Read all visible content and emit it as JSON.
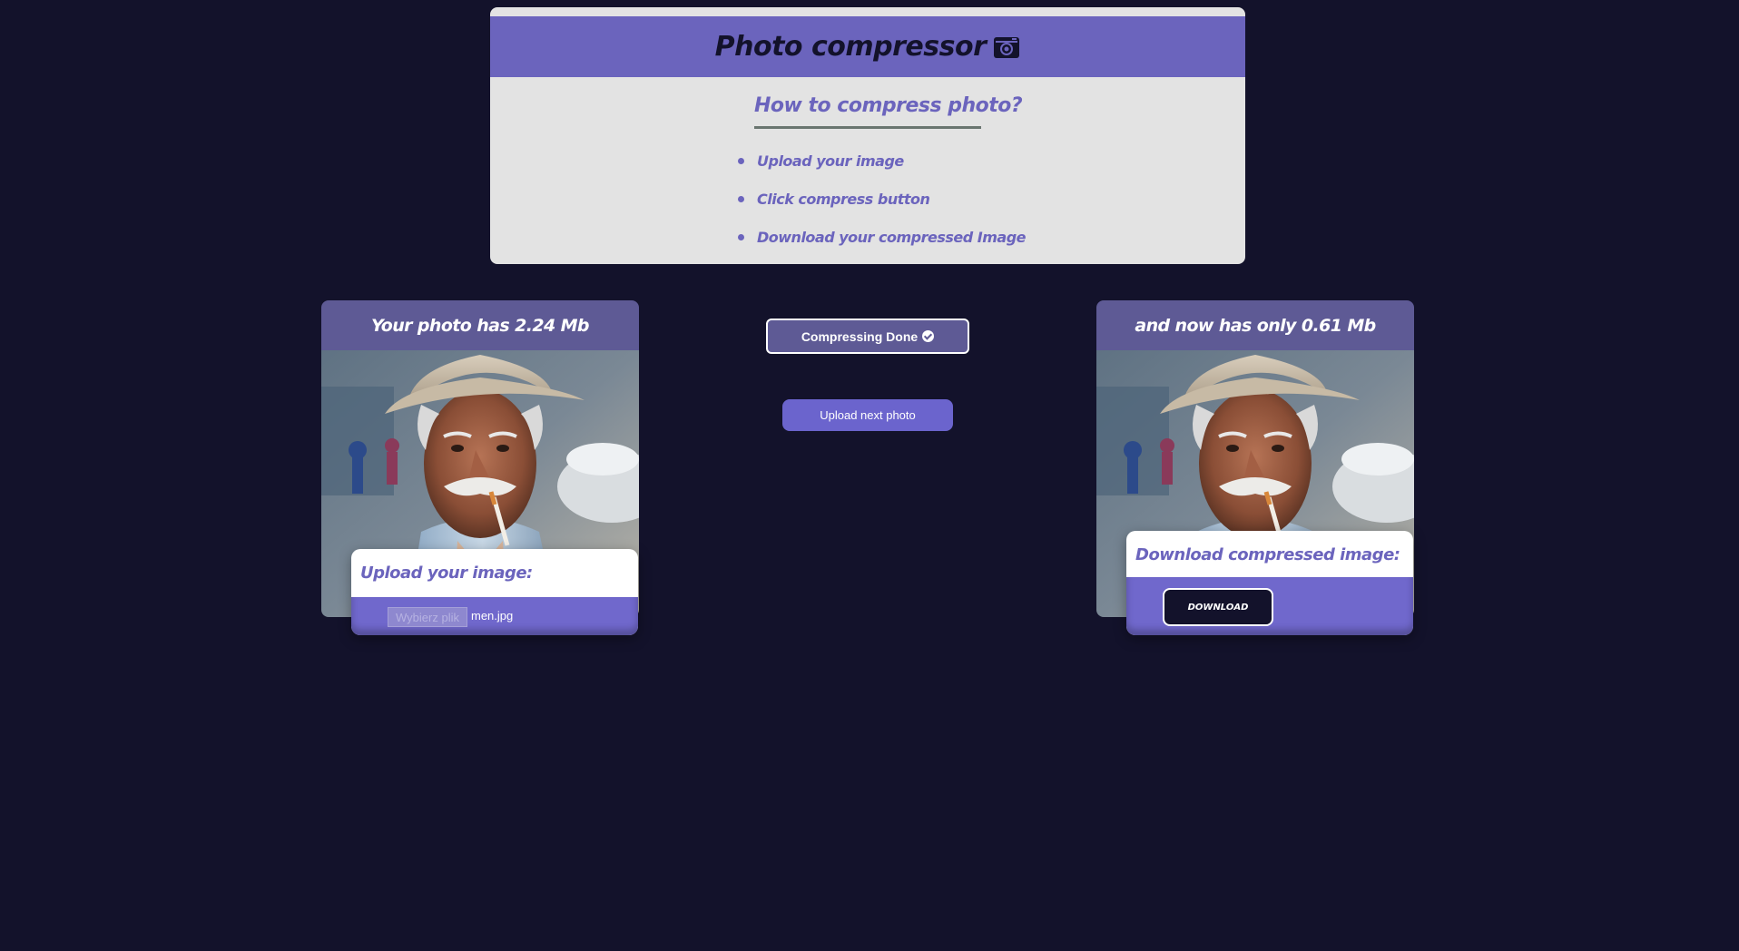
{
  "header": {
    "title": "Photo compressor",
    "icon": "camera-icon",
    "how_title": "How to compress photo?",
    "steps": [
      "Upload your image",
      "Click compress button",
      "Download your compressed Image"
    ]
  },
  "original": {
    "caption": "Your photo has 2.24 Mb",
    "panel_title": "Upload your image:",
    "file_button": "Wybierz plik",
    "file_name": "men.jpg"
  },
  "compressed": {
    "caption": "and now has only 0.61 Mb",
    "panel_title": "Download compressed image:",
    "download_label": "DOWNLOAD"
  },
  "actions": {
    "done_label": "Compressing Done",
    "next_label": "Upload next photo"
  },
  "colors": {
    "background": "#13122b",
    "accent": "#6b64bd",
    "card": "#e3e3e3"
  }
}
